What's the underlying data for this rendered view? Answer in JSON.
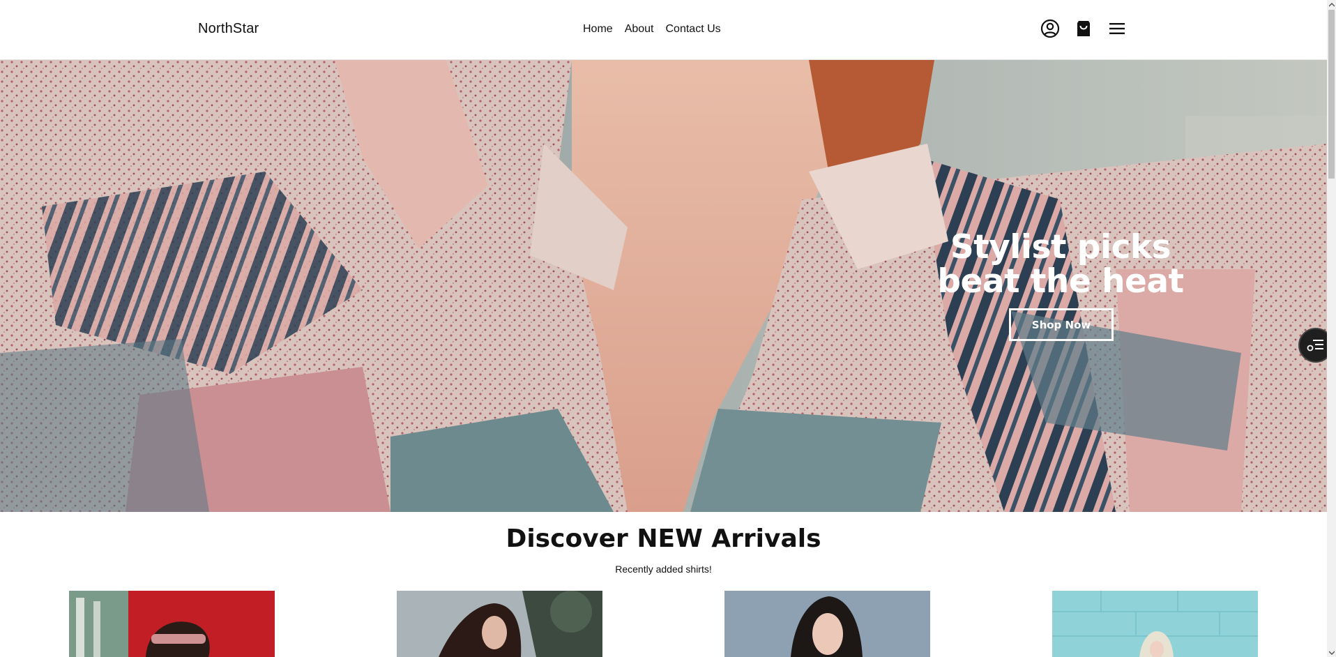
{
  "header": {
    "brand": "NorthStar",
    "nav": [
      {
        "label": "Home"
      },
      {
        "label": "About"
      },
      {
        "label": "Contact Us"
      }
    ],
    "icons": [
      "user-circle-icon",
      "shopping-bag-icon",
      "menu-icon"
    ]
  },
  "hero": {
    "title": "Stylist picks beat the heat",
    "button_label": "Shop Now"
  },
  "section": {
    "title": "Discover NEW Arrivals",
    "subtitle": "Recently added shirts!"
  },
  "products": [
    {
      "name": "product-card-1",
      "image": "woman-sunglasses-red-background"
    },
    {
      "name": "product-card-2",
      "image": "woman-long-hair-trees"
    },
    {
      "name": "product-card-3",
      "image": "woman-dark-hair-blue-background"
    },
    {
      "name": "product-card-4",
      "image": "woman-blonde-cyan-wall"
    }
  ],
  "widget": {
    "icon": "filter-list-icon"
  }
}
